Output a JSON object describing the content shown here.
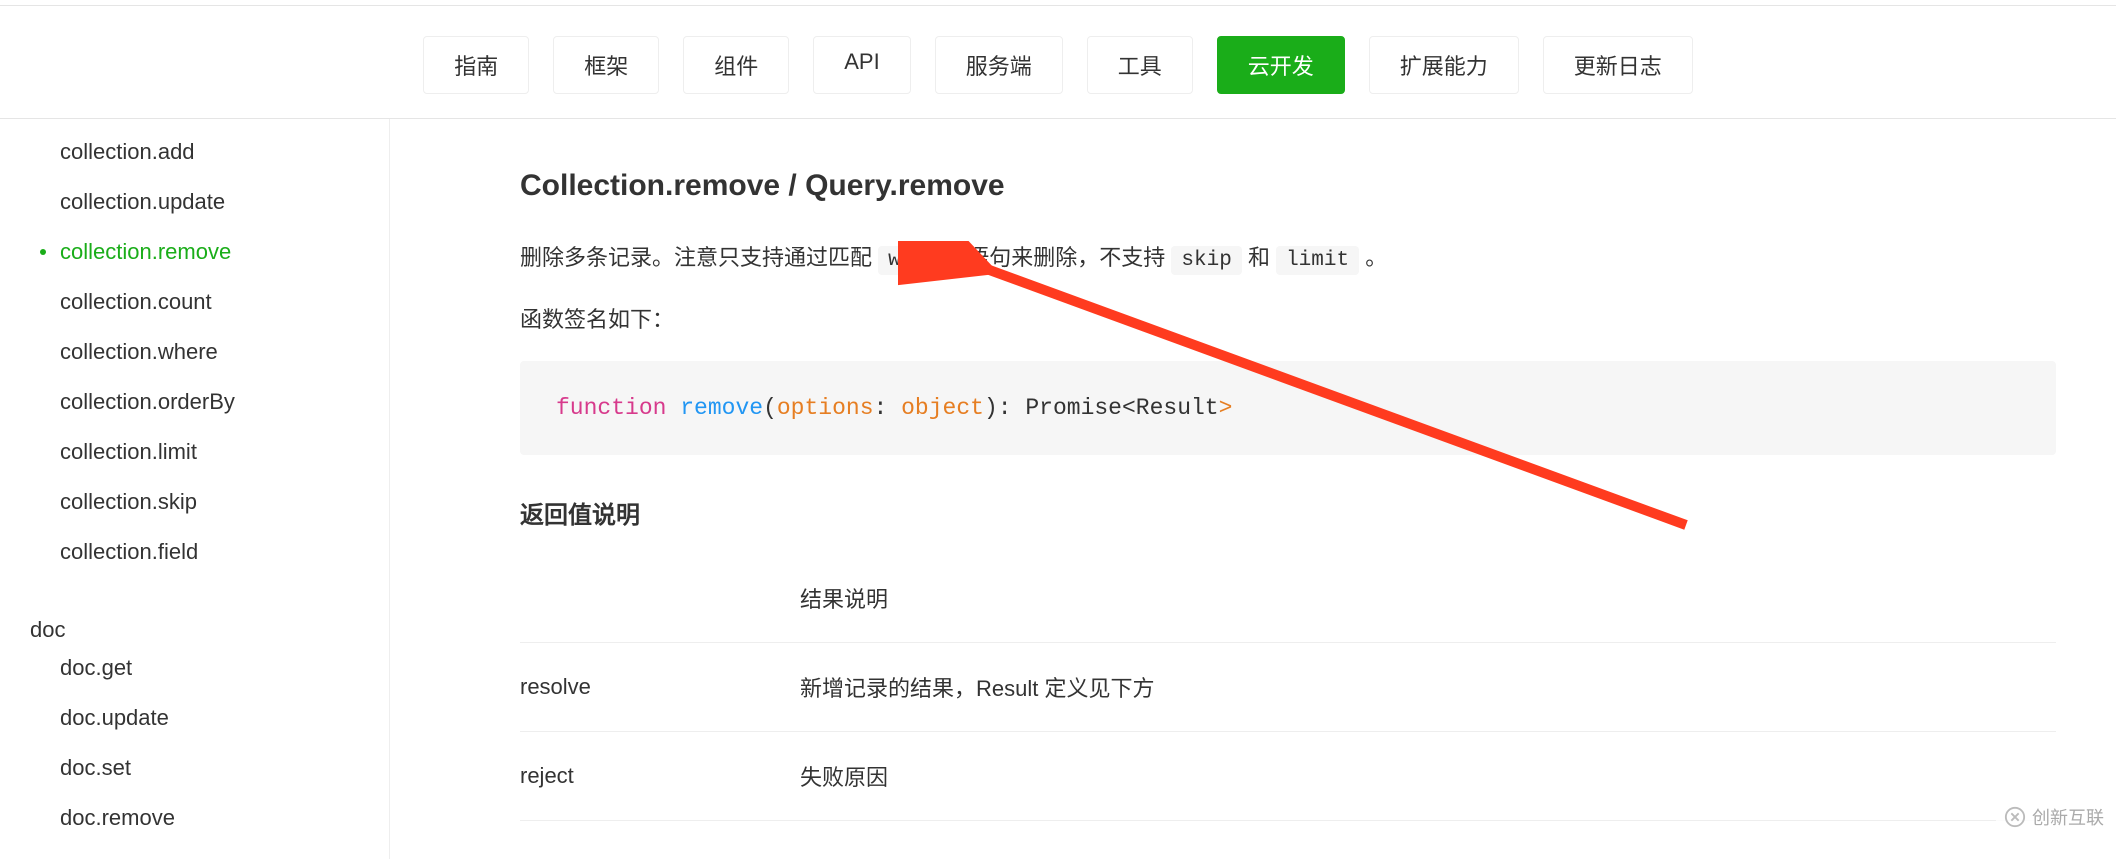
{
  "nav": {
    "items": [
      "指南",
      "框架",
      "组件",
      "API",
      "服务端",
      "工具",
      "云开发",
      "扩展能力",
      "更新日志"
    ],
    "active_index": 6
  },
  "sidebar": {
    "collection_items": [
      "collection.add",
      "collection.update",
      "collection.remove",
      "collection.count",
      "collection.where",
      "collection.orderBy",
      "collection.limit",
      "collection.skip",
      "collection.field"
    ],
    "collection_active_index": 2,
    "group_doc_label": "doc",
    "doc_items": [
      "doc.get",
      "doc.update",
      "doc.set",
      "doc.remove"
    ]
  },
  "content": {
    "heading": "Collection.remove / Query.remove",
    "desc_pre": "删除多条记录。注意只支持通过匹配 ",
    "code_where": "where",
    "desc_mid1": " 语句来删除，不支持 ",
    "code_skip": "skip",
    "desc_mid2": " 和 ",
    "code_limit": "limit",
    "desc_end": " 。",
    "sig_line": "函数签名如下：",
    "code": {
      "kw_function": "function",
      "fn_name": "remove",
      "lp": "(",
      "param_name": "options",
      "colon": ": ",
      "param_type": "object",
      "rp": ")",
      "ret_sep": ": ",
      "ret_type": "Promise",
      "lt": "<",
      "ret_inner": "Result",
      "gt": ">"
    },
    "return_title": "返回值说明",
    "table": {
      "header_desc": "结果说明",
      "rows": [
        {
          "name": "resolve",
          "desc": "新增记录的结果，Result 定义见下方"
        },
        {
          "name": "reject",
          "desc": "失败原因"
        }
      ]
    }
  },
  "watermark": "创新互联"
}
